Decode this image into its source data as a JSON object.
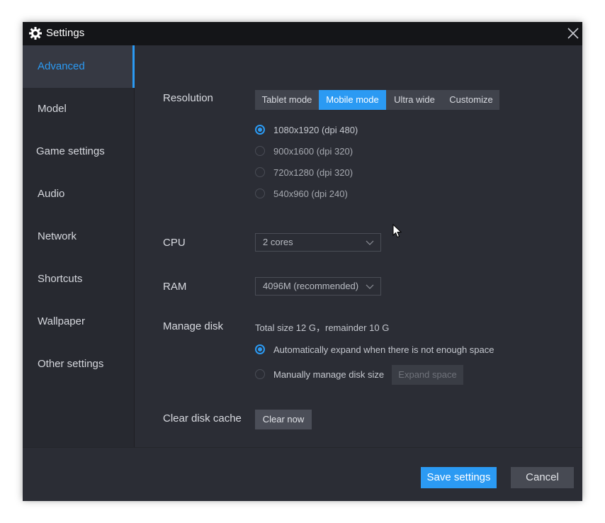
{
  "window": {
    "title": "Settings"
  },
  "sidebar": {
    "items": [
      {
        "label": "Advanced",
        "active": true
      },
      {
        "label": "Model"
      },
      {
        "label": "Game settings"
      },
      {
        "label": "Audio"
      },
      {
        "label": "Network"
      },
      {
        "label": "Shortcuts"
      },
      {
        "label": "Wallpaper"
      },
      {
        "label": "Other settings"
      }
    ]
  },
  "resolution": {
    "label": "Resolution",
    "modes": [
      "Tablet mode",
      "Mobile mode",
      "Ultra wide",
      "Customize"
    ],
    "active_mode": "Mobile mode",
    "options": [
      "1080x1920  (dpi 480)",
      "900x1600  (dpi 320)",
      "720x1280  (dpi 320)",
      "540x960  (dpi 240)"
    ],
    "selected_option": "1080x1920  (dpi 480)"
  },
  "cpu": {
    "label": "CPU",
    "value": "2 cores"
  },
  "ram": {
    "label": "RAM",
    "value": "4096M (recommended)"
  },
  "disk": {
    "label": "Manage disk",
    "info": "Total size 12 G，remainder 10 G",
    "auto_label": "Automatically expand when there is not enough space",
    "manual_label": "Manually manage disk size",
    "expand_button": "Expand space",
    "selected": "auto"
  },
  "cache": {
    "label": "Clear disk cache",
    "button": "Clear now"
  },
  "footer": {
    "save": "Save settings",
    "cancel": "Cancel"
  },
  "colors": {
    "accent": "#2b9af3",
    "window_bg": "#2b2d35",
    "titlebar_bg": "#141518",
    "sidebar_bg": "#272930"
  }
}
